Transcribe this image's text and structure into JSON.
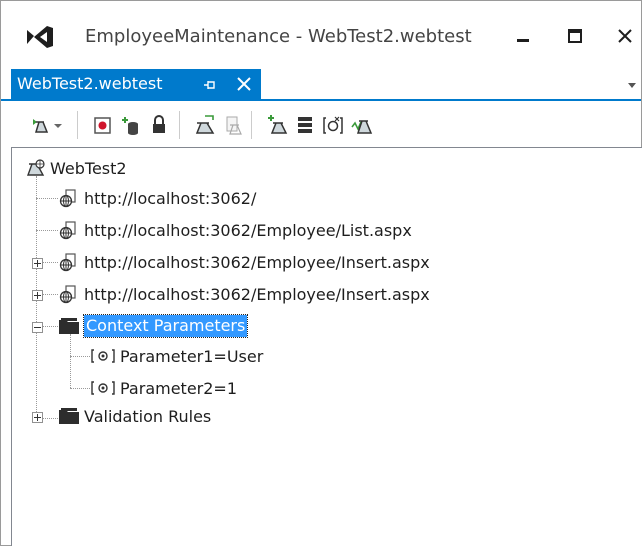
{
  "window": {
    "title": "EmployeeMaintenance - WebTest2.webtest"
  },
  "tab": {
    "label": "WebTest2.webtest"
  },
  "toolbar": {
    "buttons": [
      {
        "name": "run-test-icon"
      },
      {
        "name": "record-icon"
      },
      {
        "name": "add-data-source-icon"
      },
      {
        "name": "lock-icon"
      },
      {
        "name": "parameterize-icon"
      },
      {
        "name": "extract-icon"
      },
      {
        "name": "add-validation-icon"
      },
      {
        "name": "properties-list-icon"
      },
      {
        "name": "context-parameter-icon"
      },
      {
        "name": "create-performance-session-icon"
      }
    ]
  },
  "tree": {
    "root": "WebTest2",
    "requests": [
      "http://localhost:3062/",
      "http://localhost:3062/Employee/List.aspx",
      "http://localhost:3062/Employee/Insert.aspx",
      "http://localhost:3062/Employee/Insert.aspx"
    ],
    "context_parameters": {
      "label": "Context Parameters",
      "items": [
        "Parameter1=User",
        "Parameter2=1"
      ]
    },
    "validation_rules": "Validation Rules"
  },
  "colors": {
    "accent": "#007acc",
    "selection": "#3399ff"
  }
}
